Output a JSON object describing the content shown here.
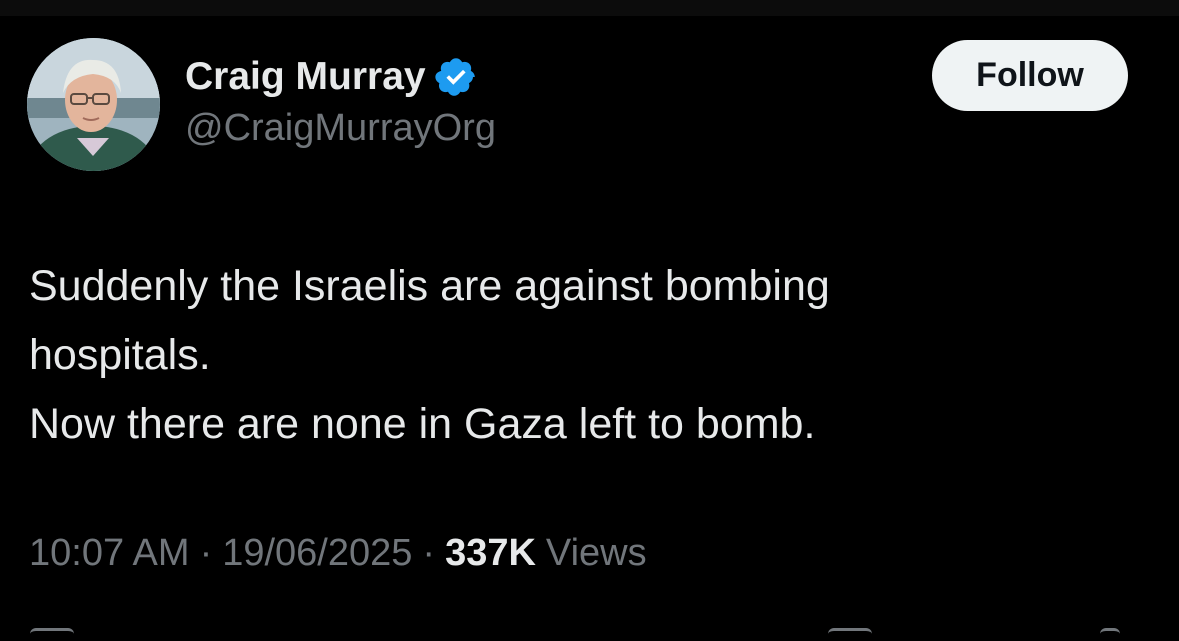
{
  "user": {
    "display_name": "Craig Murray",
    "handle": "@CraigMurrayOrg",
    "verified": true,
    "verified_color": "#1d9bf0"
  },
  "follow_button": {
    "label": "Follow"
  },
  "tweet": {
    "lines": [
      "Suddenly the Israelis are against bombing",
      "hospitals.",
      "Now there are none in Gaza left to bomb."
    ]
  },
  "meta": {
    "time": "10:07 AM",
    "separator": "·",
    "date": "19/06/2025",
    "views_count": "337K",
    "views_label": "Views"
  },
  "colors": {
    "background": "#000000",
    "text_primary": "#e7e9ea",
    "text_secondary": "#71767b",
    "button_bg": "#eff3f4"
  }
}
